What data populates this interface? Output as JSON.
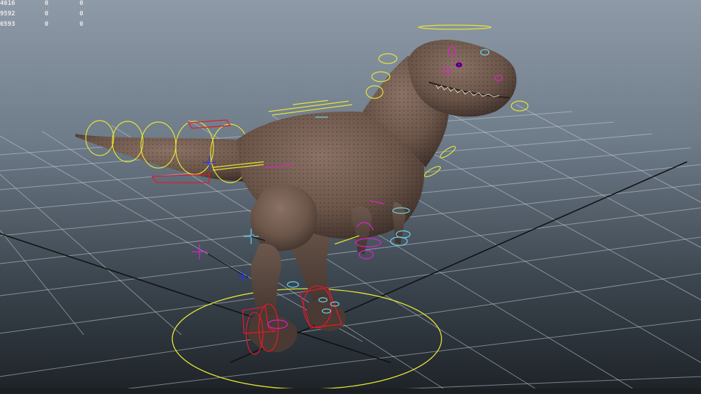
{
  "viewport": {
    "name": "3D perspective viewport",
    "background_top": "#8e9aa7",
    "background_bottom": "#1d2227"
  },
  "hud": {
    "rows": [
      {
        "label": "4616",
        "col1": "0",
        "col2": "0"
      },
      {
        "label": "9592",
        "col1": "0",
        "col2": "0"
      },
      {
        "label": "6593",
        "col1": "0",
        "col2": "0"
      }
    ]
  },
  "scene": {
    "model": "rigged tyrannosaurus",
    "model_color": "#6b5549",
    "grid_color": "#c8d0d8",
    "control_colors": {
      "yellow": "#e6e635",
      "red": "#e01a2a",
      "magenta": "#e020d0",
      "cyan": "#6ad4f0",
      "blue": "#2030ff"
    }
  }
}
